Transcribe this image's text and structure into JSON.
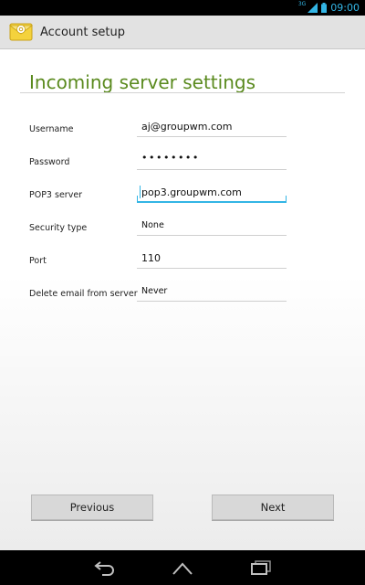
{
  "status_bar": {
    "network": "3G",
    "time": "09:00"
  },
  "action_bar": {
    "title": "Account setup",
    "icon": "email-app-icon"
  },
  "page": {
    "title": "Incoming server settings"
  },
  "form": {
    "username": {
      "label": "Username",
      "value": "aj@groupwm.com"
    },
    "password": {
      "label": "Password",
      "value": "••••••••"
    },
    "pop3_server": {
      "label": "POP3 server",
      "value": "pop3.groupwm.com"
    },
    "security_type": {
      "label": "Security type",
      "value": "None"
    },
    "port": {
      "label": "Port",
      "value": "110"
    },
    "delete_email": {
      "label": "Delete email from server",
      "value": "Never"
    }
  },
  "buttons": {
    "previous": "Previous",
    "next": "Next"
  },
  "nav_bar": {
    "back_icon": "back-icon",
    "home_icon": "home-icon",
    "recent_icon": "recent-apps-icon"
  },
  "colors": {
    "accent": "#33b5e5",
    "title_green": "#5a8a1e"
  }
}
